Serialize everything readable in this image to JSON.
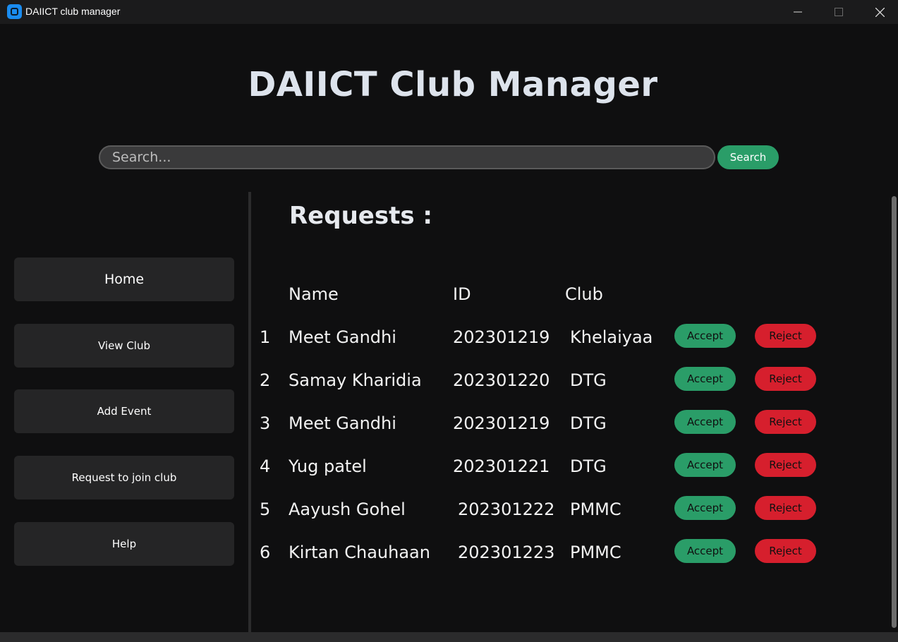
{
  "window": {
    "title": "DAIICT club manager"
  },
  "header": {
    "title": "DAIICT Club Manager"
  },
  "search": {
    "placeholder": "Search...",
    "value": "",
    "button_label": "Search"
  },
  "sidebar": {
    "items": [
      {
        "label": "Home"
      },
      {
        "label": "View Club"
      },
      {
        "label": "Add Event"
      },
      {
        "label": "Request to join club"
      },
      {
        "label": "Help"
      }
    ]
  },
  "requests": {
    "title": "Requests :",
    "columns": {
      "name": "Name",
      "id": "ID",
      "club": "Club"
    },
    "rows": [
      {
        "index": "1",
        "name": "Meet Gandhi",
        "id": "202301219",
        "club": "Khelaiyaa",
        "accept": "Accept",
        "reject": "Reject"
      },
      {
        "index": "2",
        "name": "Samay Kharidia",
        "id": "202301220",
        "club": "DTG",
        "accept": "Accept",
        "reject": "Reject"
      },
      {
        "index": "3",
        "name": "Meet Gandhi",
        "id": "202301219",
        "club": "DTG",
        "accept": "Accept",
        "reject": "Reject"
      },
      {
        "index": "4",
        "name": "Yug patel",
        "id": "202301221",
        "club": "DTG",
        "accept": "Accept",
        "reject": "Reject"
      },
      {
        "index": "5",
        "name": "Aayush Gohel",
        "id": "202301222",
        "club": "PMMC",
        "accept": "Accept",
        "reject": "Reject"
      },
      {
        "index": "6",
        "name": "Kirtan Chauhaan",
        "id": "202301223",
        "club": "PMMC",
        "accept": "Accept",
        "reject": "Reject"
      }
    ]
  },
  "colors": {
    "accept": "#2a9d68",
    "reject": "#d61f2d",
    "background": "#0f0f10",
    "button": "#252526"
  },
  "icons": {
    "app": "app-icon",
    "minimize": "minimize-icon",
    "maximize": "maximize-icon",
    "close": "close-icon"
  }
}
